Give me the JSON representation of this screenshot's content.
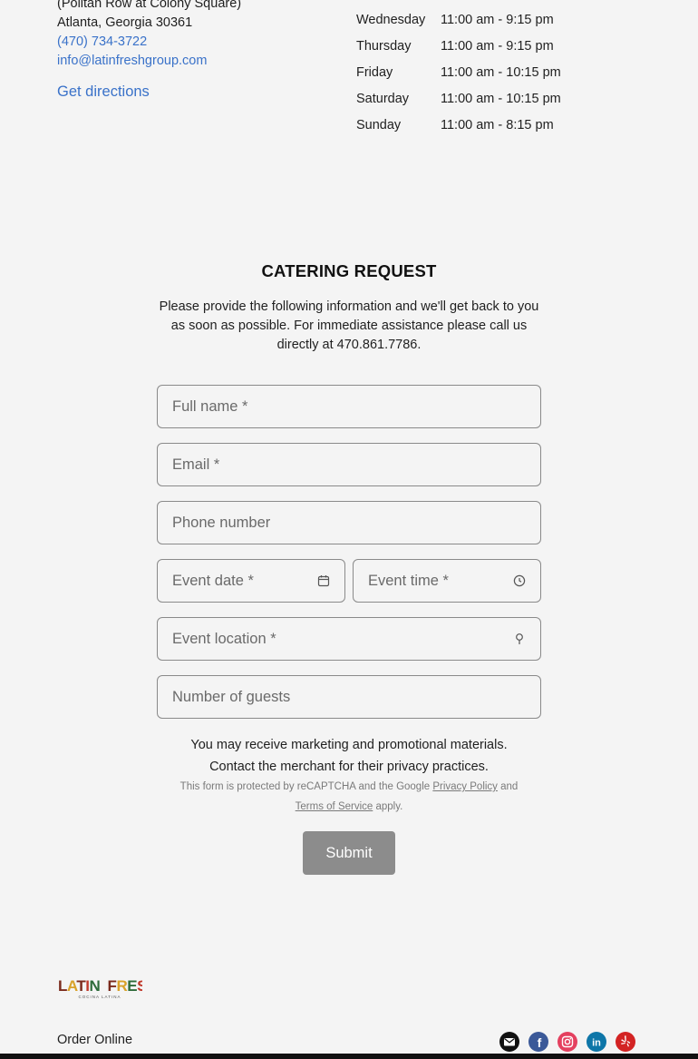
{
  "location": {
    "address_line1": "(Politan Row at Colony Square)",
    "address_line2": "Atlanta, Georgia 30361",
    "phone": "(470) 734-3722",
    "email": "info@latinfreshgroup.com",
    "directions_label": "Get directions"
  },
  "hours": [
    {
      "day": "Wednesday",
      "time": "11:00 am - 9:15 pm"
    },
    {
      "day": "Thursday",
      "time": "11:00 am - 9:15 pm"
    },
    {
      "day": "Friday",
      "time": "11:00 am - 10:15 pm"
    },
    {
      "day": "Saturday",
      "time": "11:00 am - 10:15 pm"
    },
    {
      "day": "Sunday",
      "time": "11:00 am - 8:15 pm"
    }
  ],
  "catering": {
    "title": "CATERING REQUEST",
    "intro": "Please provide the following information and we'll get back to you as soon as possible. For immediate assistance please call us directly at 470.861.7786.",
    "fields": {
      "full_name": "Full name *",
      "email": "Email *",
      "phone": "Phone number",
      "event_date": "Event date *",
      "event_time": "Event time *",
      "event_location": "Event location *",
      "guests": "Number of guests"
    },
    "consent_line1": "You may receive marketing and promotional materials.",
    "consent_line2": "Contact the merchant for their privacy practices.",
    "recaptcha_prefix": "This form is protected by reCAPTCHA and the Google",
    "privacy_link": "Privacy Policy",
    "recaptcha_and": "and",
    "terms_link": "Terms of Service",
    "recaptcha_suffix": "apply.",
    "submit_label": "Submit"
  },
  "footer": {
    "logo_text": "LATIN FRESH",
    "logo_subtext": "COCINA LATINA",
    "order_online": "Order Online",
    "social_icons": [
      "email-icon",
      "facebook-icon",
      "instagram-icon",
      "linkedin-icon",
      "yelp-icon"
    ]
  },
  "colors": {
    "link": "#3a72c9",
    "submit_bg": "#8c8c8c",
    "email": "#111111",
    "facebook": "#3b5998",
    "instagram": "#e4405f",
    "linkedin": "#0e76a8",
    "yelp": "#d32323"
  }
}
